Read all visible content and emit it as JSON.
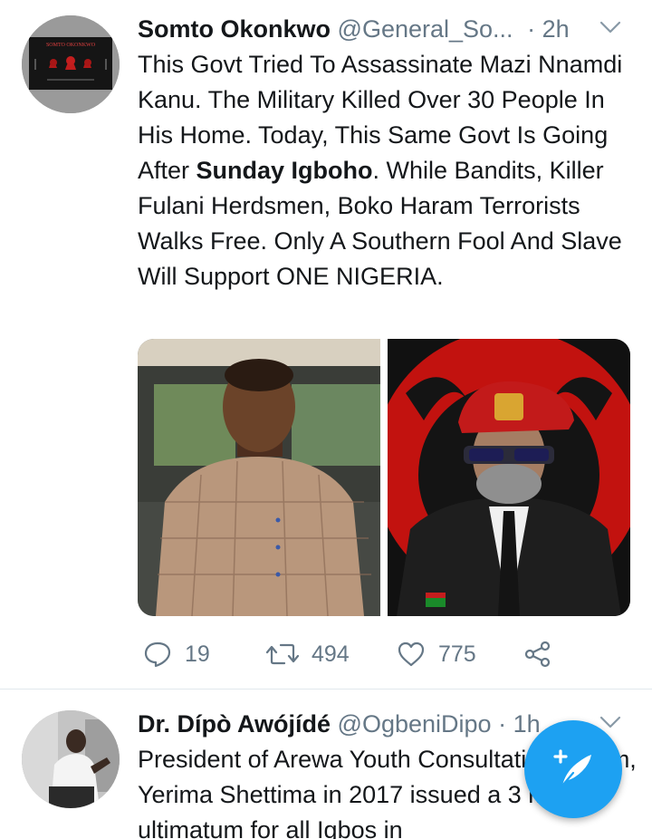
{
  "tweets": [
    {
      "name": "Somto Okonkwo",
      "handle": "@General_So...",
      "separator": "·",
      "time": "2h",
      "avatar_text": "SOMTO OKONKWO",
      "text_parts": [
        "This Govt Tried To Assassinate Mazi Nnamdi Kanu. The Military Killed Over 30 People In His Home. Today, This Same Govt Is Going After ",
        "Sunday Igboho",
        ". While Bandits, Killer Fulani Herdsmen, Boko Haram Terrorists Walks Free. Only A Southern Fool And Slave Will Support ONE NIGERIA."
      ],
      "replies": "19",
      "retweets": "494",
      "likes": "775"
    },
    {
      "name": "Dr. Dípò Awójídé",
      "handle": "@OgbeniDipo",
      "separator": "·",
      "time": "1h",
      "text_parts": [
        "President of Arewa Youth Consultative Forum, Yerima Shettima in 2017 issued a 3 months ultimatum for all Igbos in"
      ]
    }
  ],
  "colors": {
    "accent": "#1da1f2",
    "secondary_text": "#657786",
    "divider": "#e1e8ed"
  },
  "icons": {
    "reply": "speech-bubble-icon",
    "retweet": "retweet-icon",
    "like": "heart-icon",
    "share": "share-icon",
    "menu": "chevron-down-icon",
    "compose": "compose-tweet-icon"
  }
}
